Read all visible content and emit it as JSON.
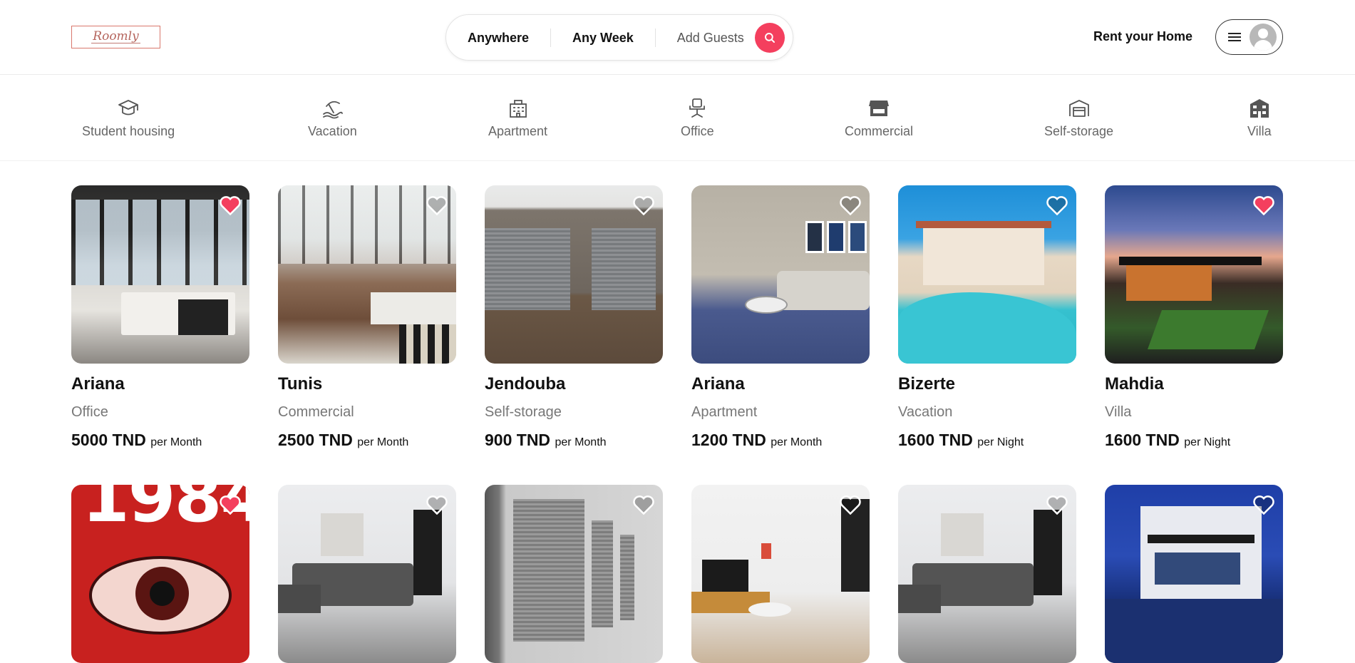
{
  "brand": {
    "logo_text": "Roomly",
    "accent_color": "#f43f5e"
  },
  "search": {
    "where": "Anywhere",
    "when": "Any Week",
    "guests": "Add Guests",
    "icon": "search-icon"
  },
  "header": {
    "rent_link": "Rent your Home",
    "menu_icon": "menu-icon",
    "avatar_icon": "avatar-icon"
  },
  "categories": [
    {
      "label": "Student housing",
      "icon": "graduation-cap-icon"
    },
    {
      "label": "Vacation",
      "icon": "beach-icon"
    },
    {
      "label": "Apartment",
      "icon": "building-icon"
    },
    {
      "label": "Office",
      "icon": "office-chair-icon"
    },
    {
      "label": "Commercial",
      "icon": "store-icon"
    },
    {
      "label": "Self-storage",
      "icon": "garage-icon"
    },
    {
      "label": "Villa",
      "icon": "villa-icon"
    }
  ],
  "listings": [
    {
      "city": "Ariana",
      "type": "Office",
      "price": "5000 TND",
      "period": "per Month",
      "favorited": true
    },
    {
      "city": "Tunis",
      "type": "Commercial",
      "price": "2500 TND",
      "period": "per Month",
      "favorited": false
    },
    {
      "city": "Jendouba",
      "type": "Self-storage",
      "price": "900 TND",
      "period": "per Month",
      "favorited": false
    },
    {
      "city": "Ariana",
      "type": "Apartment",
      "price": "1200 TND",
      "period": "per Month",
      "favorited": false
    },
    {
      "city": "Bizerte",
      "type": "Vacation",
      "price": "1600 TND",
      "period": "per Night",
      "favorited": false
    },
    {
      "city": "Mahdia",
      "type": "Villa",
      "price": "1600 TND",
      "period": "per Night",
      "favorited": true
    },
    {
      "favorited": true,
      "image_text": "1984"
    },
    {
      "favorited": false
    },
    {
      "favorited": false
    },
    {
      "favorited": false
    },
    {
      "favorited": false
    },
    {
      "favorited": false
    }
  ]
}
